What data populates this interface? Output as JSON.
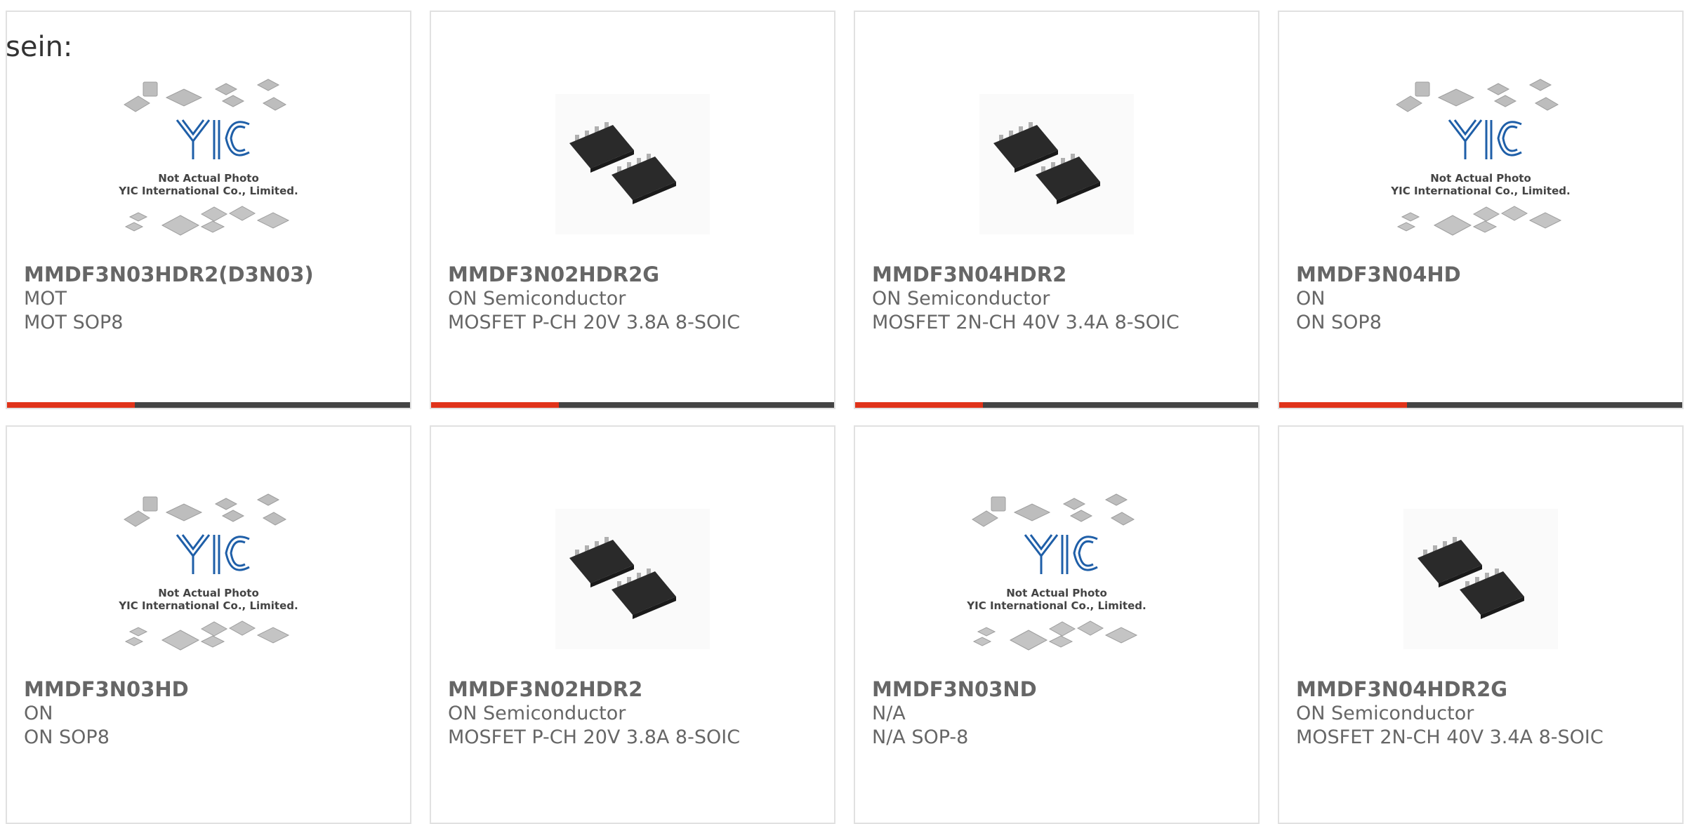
{
  "intro_text": "sein:",
  "placeholder_caption": {
    "line1": "Not Actual Photo",
    "line2": "YIC International Co., Limited."
  },
  "accent_color": "#e0331a",
  "products": [
    {
      "part": "MMDF3N03HDR2(D3N03)",
      "manufacturer": "MOT",
      "description": "MOT SOP8",
      "image": "placeholder-photo"
    },
    {
      "part": "MMDF3N02HDR2G",
      "manufacturer": "ON Semiconductor",
      "description": "MOSFET P-CH 20V 3.8A 8-SOIC",
      "image": "soic8-chip-photo"
    },
    {
      "part": "MMDF3N04HDR2",
      "manufacturer": "ON Semiconductor",
      "description": "MOSFET 2N-CH 40V 3.4A 8-SOIC",
      "image": "soic8-chip-photo"
    },
    {
      "part": "MMDF3N04HD",
      "manufacturer": "ON",
      "description": "ON SOP8",
      "image": "placeholder-photo"
    },
    {
      "part": "MMDF3N03HD",
      "manufacturer": "ON",
      "description": "ON SOP8",
      "image": "placeholder-photo"
    },
    {
      "part": "MMDF3N02HDR2",
      "manufacturer": "ON Semiconductor",
      "description": "MOSFET P-CH 20V 3.8A 8-SOIC",
      "image": "soic8-chip-photo"
    },
    {
      "part": "MMDF3N03ND",
      "manufacturer": "N/A",
      "description": "N/A SOP-8",
      "image": "placeholder-photo"
    },
    {
      "part": "MMDF3N04HDR2G",
      "manufacturer": "ON Semiconductor",
      "description": "MOSFET 2N-CH 40V 3.4A 8-SOIC",
      "image": "soic8-chip-photo"
    }
  ]
}
